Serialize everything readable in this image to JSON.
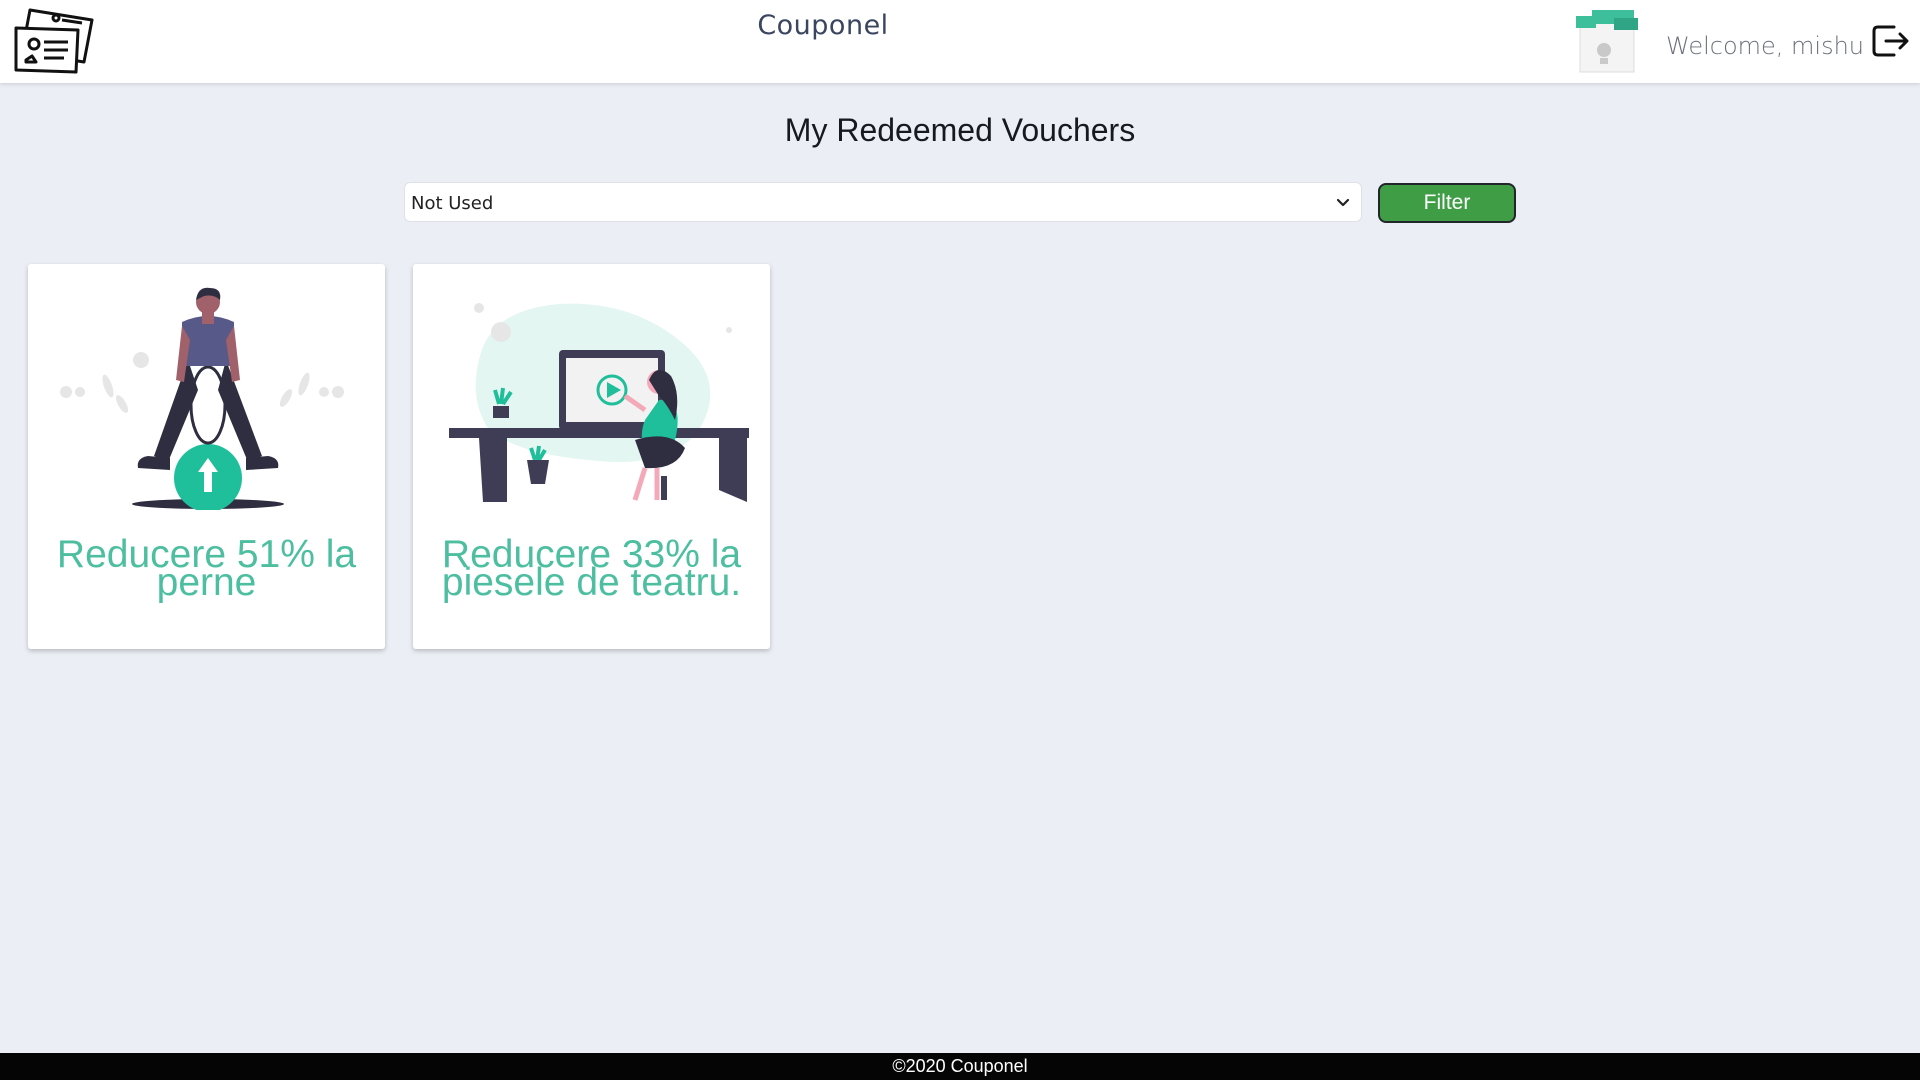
{
  "header": {
    "brand": "Couponel",
    "welcome": "Welcome, mishu",
    "icons": [
      "voucher-logo-icon",
      "user-avatar-icon",
      "logout-icon"
    ]
  },
  "main": {
    "title": "My Redeemed Vouchers",
    "filter": {
      "selected": "Not Used",
      "button_label": "Filter"
    },
    "vouchers": [
      {
        "title": "Reducere 51% la perne",
        "illustration": "person-on-ball-icon"
      },
      {
        "title": "Reducere 33% la piesele de teatru.",
        "illustration": "desk-video-illustration-icon"
      }
    ]
  },
  "footer": {
    "text": "©2020 Couponel"
  },
  "colors": {
    "background": "#ebeef5",
    "accent_teal": "#4dbfa0",
    "filter_button": "#3f9e45",
    "footer_bg": "#050505"
  }
}
